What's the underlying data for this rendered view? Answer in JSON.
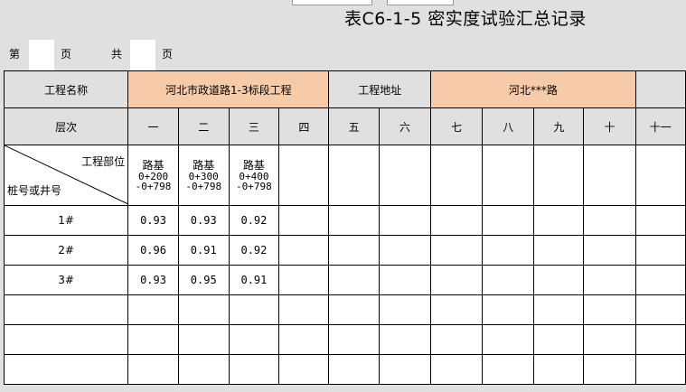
{
  "title": "表C6-1-5  密实度试验汇总记录",
  "pager": {
    "page_label": "第",
    "page_unit": "页",
    "total_label": "共",
    "total_unit": "页"
  },
  "project": {
    "name_label": "工程名称",
    "name_value": "河北市政道路1-3标段工程",
    "address_label": "工程地址",
    "address_value": "河北***路"
  },
  "levels": {
    "label": "层次",
    "items": [
      "一",
      "二",
      "三",
      "四",
      "五",
      "六",
      "七",
      "八",
      "九",
      "十",
      "十一"
    ]
  },
  "locations": {
    "header_top": "工程部位",
    "header_bottom": "桩号或井号",
    "items": [
      {
        "name": "路基",
        "range1": "0+200",
        "range2": "-0+798"
      },
      {
        "name": "路基",
        "range1": "0+300",
        "range2": "-0+798"
      },
      {
        "name": "路基",
        "range1": "0+400",
        "range2": "-0+798"
      }
    ]
  },
  "rows": [
    {
      "id": "1#",
      "values": [
        "0.93",
        "0.93",
        "0.92"
      ]
    },
    {
      "id": "2#",
      "values": [
        "0.96",
        "0.91",
        "0.92"
      ]
    },
    {
      "id": "3#",
      "values": [
        "0.93",
        "0.95",
        "0.91"
      ]
    }
  ],
  "colors": {
    "header_fill": "#e0e0e0",
    "highlight_fill": "#f7cba8"
  }
}
